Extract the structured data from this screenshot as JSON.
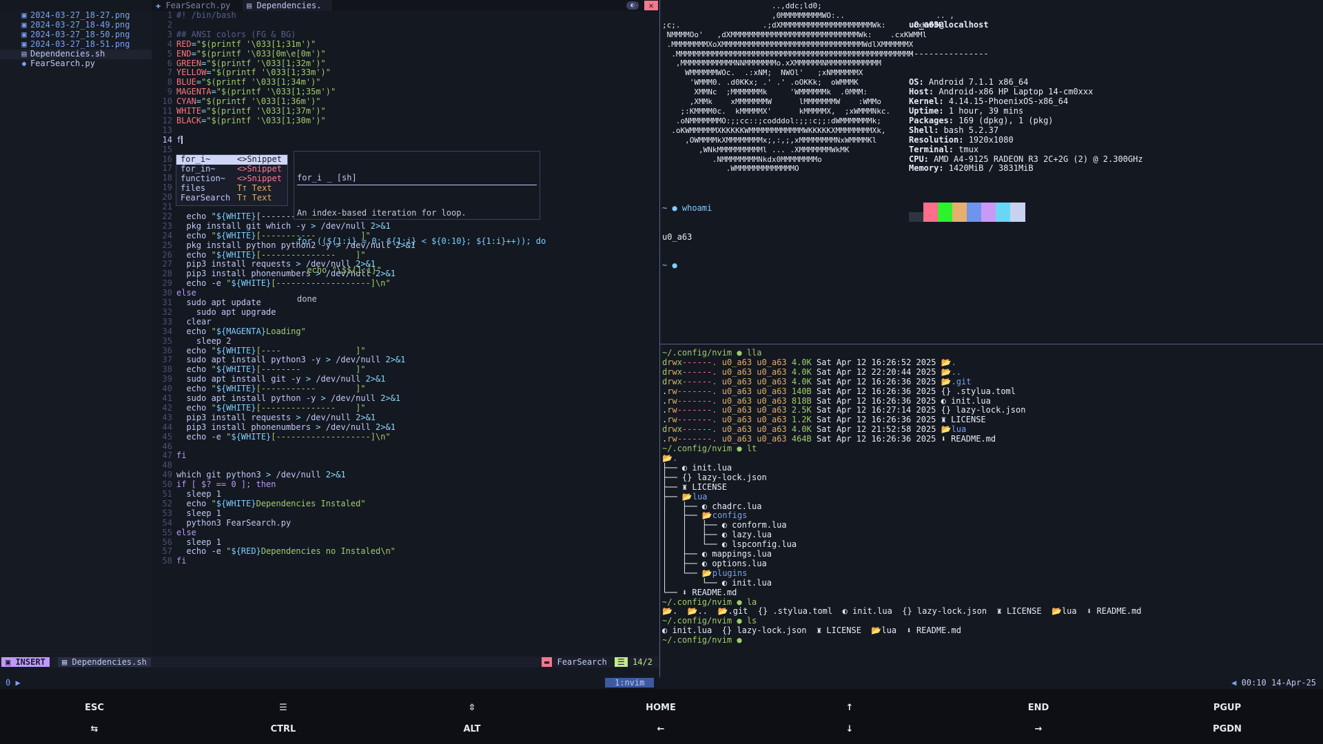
{
  "sidebar": {
    "files": [
      {
        "icon": "image-icon",
        "name": "2024-03-27_18-27.png"
      },
      {
        "icon": "image-icon",
        "name": "2024-03-27_18-49.png"
      },
      {
        "icon": "image-icon",
        "name": "2024-03-27_18-50.png"
      },
      {
        "icon": "image-icon",
        "name": "2024-03-27_18-51.png"
      },
      {
        "icon": "shell-icon",
        "name": "Dependencies.sh"
      },
      {
        "icon": "python-icon",
        "name": "FearSearch.py"
      }
    ]
  },
  "tabs": [
    {
      "label": "FearSearch.py",
      "close": "×"
    },
    {
      "label": "Dependencies.",
      "modified": "●"
    }
  ],
  "editor": {
    "lines": [
      {
        "n": "1",
        "t": "#! /bin/bash",
        "c": "cm"
      },
      {
        "n": "2",
        "t": ""
      },
      {
        "n": "3",
        "t": "## ANSI colors (FG & BG)",
        "c": "cm"
      },
      {
        "n": "4",
        "t": "RED=\"$(printf '\\033[1;31m')\""
      },
      {
        "n": "5",
        "t": "END=\"$(printf '\\033[0m\\e[0m')\""
      },
      {
        "n": "6",
        "t": "GREEN=\"$(printf '\\033[1;32m')\""
      },
      {
        "n": "7",
        "t": "YELLOW=\"$(printf '\\033[1;33m')\""
      },
      {
        "n": "8",
        "t": "BLUE=\"$(printf '\\033[1;34m')\""
      },
      {
        "n": "9",
        "t": "MAGENTA=\"$(printf '\\033[1;35m')\""
      },
      {
        "n": "10",
        "t": "CYAN=\"$(printf '\\033[1;36m')\""
      },
      {
        "n": "11",
        "t": "WHITE=\"$(printf '\\033[1;37m')\""
      },
      {
        "n": "12",
        "t": "BLACK=\"$(printf '\\033[1;30m')\""
      },
      {
        "n": "13",
        "t": ""
      },
      {
        "n": "14",
        "t": "f"
      },
      {
        "n": "15",
        "t": ""
      },
      {
        "n": "16",
        "t": ""
      },
      {
        "n": "17",
        "t": ""
      },
      {
        "n": "18",
        "t": ""
      },
      {
        "n": "19",
        "t": ""
      },
      {
        "n": "20",
        "t": ""
      },
      {
        "n": "21",
        "t": ""
      },
      {
        "n": "22",
        "t": "  echo \"${WHITE}[-------"
      },
      {
        "n": "23",
        "t": "  pkg install git which -y > /dev/null 2>&1"
      },
      {
        "n": "24",
        "t": "  echo \"${WHITE}[-----------         ]\""
      },
      {
        "n": "25",
        "t": "  pkg install python python2 -y > /dev/null 2>&1"
      },
      {
        "n": "26",
        "t": "  echo \"${WHITE}[---------------    ]\""
      },
      {
        "n": "27",
        "t": "  pip3 install requests > /dev/null 2>&1"
      },
      {
        "n": "28",
        "t": "  pip3 install phonenumbers > /dev/null 2>&1"
      },
      {
        "n": "29",
        "t": "  echo -e \"${WHITE}[-------------------]\\n\""
      },
      {
        "n": "30",
        "t": "else",
        "c": "kw"
      },
      {
        "n": "31",
        "t": "  sudo apt update"
      },
      {
        "n": "32",
        "t": "    sudo apt upgrade"
      },
      {
        "n": "33",
        "t": "  clear"
      },
      {
        "n": "34",
        "t": "  echo \"${MAGENTA}Loading\""
      },
      {
        "n": "35",
        "t": "    sleep 2"
      },
      {
        "n": "36",
        "t": "  echo \"${WHITE}[----               ]\""
      },
      {
        "n": "37",
        "t": "  sudo apt install python3 -y > /dev/null 2>&1"
      },
      {
        "n": "38",
        "t": "  echo \"${WHITE}[--------           ]\""
      },
      {
        "n": "39",
        "t": "  sudo apt install git -y > /dev/null 2>&1"
      },
      {
        "n": "40",
        "t": "  echo \"${WHITE}[-----------        ]\""
      },
      {
        "n": "41",
        "t": "  sudo apt install python -y > /dev/null 2>&1"
      },
      {
        "n": "42",
        "t": "  echo \"${WHITE}[---------------    ]\""
      },
      {
        "n": "43",
        "t": "  pip3 install requests > /dev/null 2>&1"
      },
      {
        "n": "44",
        "t": "  pip3 install phonenumbers > /dev/null 2>&1"
      },
      {
        "n": "45",
        "t": "  echo -e \"${WHITE}[-------------------]\\n\""
      },
      {
        "n": "46",
        "t": ""
      },
      {
        "n": "47",
        "t": "fi",
        "c": "kw"
      },
      {
        "n": "48",
        "t": ""
      },
      {
        "n": "49",
        "t": "which git python3 > /dev/null 2>&1"
      },
      {
        "n": "50",
        "t": "if [ $? == 0 ]; then",
        "c": "kw"
      },
      {
        "n": "51",
        "t": "  sleep 1"
      },
      {
        "n": "52",
        "t": "  echo \"${WHITE}Dependencies Instaled\""
      },
      {
        "n": "53",
        "t": "  sleep 1"
      },
      {
        "n": "54",
        "t": "  python3 FearSearch.py"
      },
      {
        "n": "55",
        "t": "else",
        "c": "kw"
      },
      {
        "n": "56",
        "t": "  sleep 1"
      },
      {
        "n": "57",
        "t": "  echo -e \"${RED}Dependencies no Instaled\\n\""
      },
      {
        "n": "58",
        "t": "fi",
        "c": "kw"
      }
    ]
  },
  "completion": {
    "items": [
      {
        "label": "for_i~",
        "kind": "<>Snippet",
        "selected": true
      },
      {
        "label": "for_in~",
        "kind": "<>Snippet"
      },
      {
        "label": "function~",
        "kind": "<>Snippet"
      },
      {
        "label": "files",
        "kind": "Tт Text"
      },
      {
        "label": "FearSearch",
        "kind": "Tт Text"
      }
    ]
  },
  "doc": {
    "title": "for_i _ [sh]",
    "desc": "An index-based iteration for loop.",
    "code": [
      "for ((${1:i} = 0; ${1:i} < ${0:10}; ${1:i}++)); do",
      "  echo \"\\$${1:i}\"",
      "done"
    ]
  },
  "statusline": {
    "mode": "INSERT",
    "file": "Dependencies.sh",
    "project": "FearSearch",
    "position": "14/2"
  },
  "neofetch": {
    "art": [
      "                        ..,ddc;ld0;",
      "                        ,0MMMMMMMMMWO:..                    .. ,",
      ";c;.                  .;dXMMMMMMMMMMMMMMMMMMMMWk:     .cxKWMMl",
      " NMMMMOo'   ,dXMMMMMMMMMMMMMMMMMMMMMMMMMMMMWk:    .cxKWMMl",
      " .MMMMMMMMXoXMMMMMMMMMMMMMMMMMMMMMMMMMMMMMMMWdlXMMMMMMX",
      "  .MMMMMMMMMMMMMMMMMMMMMMMMMMMMMMMMMMMMMMMMMMMMMMMMMMMM",
      "   ,MMMMMMMMMMMMNNMMMMMMMo.xXMMMMMMNMMMMMMMMMMMM",
      "     WMMMMMMWOc.  .:xNM;  NWOl'   ;xNMMMMMMX",
      "      'WMMM0. .d0KKx; .' .' .oOKKk;  oWMMMK",
      "       XMMNc  ;MMMMMMMk     'WMMMMMMk  .0MMM:",
      "      ,XMMk    xMMMMMMMW      lMMMMMMMW    :WMMo",
      "    ;:KMMMM0c.  kMMMMMX'      kMMMMMX,  ;xWMMMNkc.",
      "   .oNMMMMMMMO:;;cc::;codddol:;;:c;;:dWMMMMMMMk;",
      "  .oKWMMMMMMXKKKKKWMMMMMMMMMMMMWKKKKKXMMMMMMMMXk,",
      "     ,OWMMMMkXMMMMMMMMx;,:,;,xMMMMMMMMNxWMMMMKl",
      "        ,WNkMMMMMMMMMMl ... .XMMMMMMMWkMK",
      "           .NMMMMMMMMNkdx0MMMMMMMMo",
      "              .WMMMMMMMMMMMMMO"
    ],
    "user": "u0_a63@localhost",
    "sep": "----------------",
    "info": [
      [
        "OS:",
        " Android 7.1.1 x86_64"
      ],
      [
        "Host:",
        " Android-x86 HP Laptop 14-cm0xxx"
      ],
      [
        "Kernel:",
        " 4.14.15-PhoenixOS-x86_64"
      ],
      [
        "Uptime:",
        " 1 hour, 39 mins"
      ],
      [
        "Packages:",
        " 169 (dpkg), 1 (pkg)"
      ],
      [
        "Shell:",
        " bash 5.2.37"
      ],
      [
        "Resolution:",
        " 1920x1080"
      ],
      [
        "Terminal:",
        " tmux"
      ],
      [
        "CPU:",
        " AMD A4-9125 RADEON R3 2C+2G (2) @ 2.300GHz"
      ],
      [
        "Memory:",
        " 1420MiB / 3831MiB"
      ]
    ],
    "swatches": [
      "#2e3440",
      "#ff6e8a",
      "#2ef22e",
      "#e5b06e",
      "#6e94ee",
      "#c89af6",
      "#6ad6f6",
      "#c8d2f0"
    ]
  },
  "term_top": {
    "prompt1": "~ ● whoami",
    "out": "u0_a63",
    "prompt2": "~ ●"
  },
  "term_bottom": {
    "cmd1": "~/.config/nvim ● lla",
    "lla": [
      [
        "drwx------.",
        "4.0K",
        "Sat Apr 12 16:26:52 2025",
        "dir",
        ".",
        ""
      ],
      [
        "drwx------.",
        "4.0K",
        "Sat Apr 12 22:20:44 2025",
        "dir",
        "..",
        ""
      ],
      [
        "drwx------.",
        "4.0K",
        "Sat Apr 12 16:26:36 2025",
        "dir",
        ".git",
        ""
      ],
      [
        ".rw-------.",
        "140B",
        "Sat Apr 12 16:26:36 2025",
        "file",
        ".stylua.toml",
        "{}"
      ],
      [
        ".rw-------.",
        "818B",
        "Sat Apr 12 16:26:36 2025",
        "file",
        "init.lua",
        "◐"
      ],
      [
        ".rw-------.",
        "2.5K",
        "Sat Apr 12 16:27:14 2025",
        "file",
        "lazy-lock.json",
        "{}"
      ],
      [
        ".rw-------.",
        "1.2K",
        "Sat Apr 12 16:26:36 2025",
        "file",
        "LICENSE",
        "♜"
      ],
      [
        "drwx------.",
        "4.0K",
        "Sat Apr 12 21:52:58 2025",
        "dir",
        "lua",
        ""
      ],
      [
        ".rw-------.",
        "464B",
        "Sat Apr 12 16:26:36 2025",
        "file",
        "README.md",
        "⬇"
      ]
    ],
    "owner": "u0_a63 u0_a63",
    "cmd2": "~/.config/nvim ● lt",
    "tree": [
      "📂.",
      "├── ◐ init.lua",
      "├── {} lazy-lock.json",
      "├── ♜ LICENSE",
      "├── 📂lua",
      "│   ├── ◐ chadrc.lua",
      "│   ├── 📂configs",
      "│   │   ├── ◐ conform.lua",
      "│   │   ├── ◐ lazy.lua",
      "│   │   └── ◐ lspconfig.lua",
      "│   ├── ◐ mappings.lua",
      "│   ├── ◐ options.lua",
      "│   └── 📂plugins",
      "│       └── ◐ init.lua",
      "└── ⬇ README.md"
    ],
    "cmd3": "~/.config/nvim ● la",
    "la": "📂.  📂..  📂.git  {} .stylua.toml  ◐ init.lua  {} lazy-lock.json  ♜ LICENSE  📂lua  ⬇ README.md",
    "cmd4": "~/.config/nvim ● ls",
    "ls": "◐ init.lua  {} lazy-lock.json  ♜ LICENSE  📂lua  ⬇ README.md",
    "cmd5": "~/.config/nvim ●"
  },
  "tmux": {
    "session": "0",
    "window": "1:nvim",
    "clock": "00:10 14-Apr-25"
  },
  "keys": {
    "row1": [
      "ESC",
      "☰",
      "⇳",
      "HOME",
      "↑",
      "END",
      "PGUP"
    ],
    "row2": [
      "⇆",
      "CTRL",
      "ALT",
      "←",
      "↓",
      "→",
      "PGDN"
    ]
  }
}
